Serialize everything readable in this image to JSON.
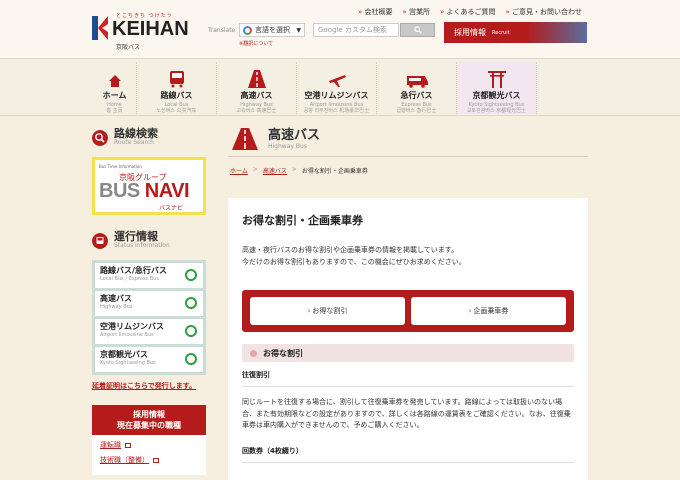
{
  "header": {
    "logo_top": "とこちきち つけたう",
    "logo_main": "KEIHAN",
    "logo_sub": "京阪バス",
    "top_links": [
      "会社概要",
      "営業所",
      "よくあるご質問",
      "ご意見・お問い合わせ"
    ],
    "translate_label": "Translate",
    "translate_select": "言語を選択",
    "translate_note": "※翻訳について",
    "search_placeholder": "Google カスタム検索",
    "recruit_label": "採用情報",
    "recruit_en": "Recruit"
  },
  "nav": {
    "items": [
      {
        "label": "ホーム",
        "sub": "Home\n홈 主页",
        "icon": "home-icon"
      },
      {
        "label": "路線バス",
        "sub": "Local Bus\n노선버스 公共汽车",
        "icon": "local-bus-icon"
      },
      {
        "label": "高速バス",
        "sub": "Highway Bus\n고속버스 高速巴士",
        "icon": "highway-icon"
      },
      {
        "label": "空港リムジンバス",
        "sub": "Airport limousine Bus\n공항 리무진버스 机场豪华巴士",
        "icon": "airplane-icon"
      },
      {
        "label": "急行バス",
        "sub": "Express Bus\n급행버스 急行巴士",
        "icon": "express-bus-icon"
      },
      {
        "label": "京都観光バス",
        "sub": "Kyoto Sightseeing Bus\n교토관광버스 京都观光巴士",
        "icon": "torii-icon"
      }
    ]
  },
  "sidebar": {
    "route_search": {
      "title": "路線検索",
      "sub": "Route Search"
    },
    "busnavi": {
      "small": "Bus Time Information",
      "group": "京阪グループ",
      "bus": "BUS",
      "navi": "NAVI",
      "kana": "バスナビ"
    },
    "status": {
      "title": "運行情報",
      "sub": "Status Information",
      "rows": [
        {
          "name": "路線バス/急行バス",
          "sub": "Local Bus / Express Bus"
        },
        {
          "name": "高速バス",
          "sub": "Highway Bus"
        },
        {
          "name": "空港リムジンバス",
          "sub": "Airport limousine Bus"
        },
        {
          "name": "京都観光バス",
          "sub": "Kyoto Sightseeing Bus"
        }
      ]
    },
    "delay_link": "延着証明はこちらで発行します。",
    "recruit": {
      "head1": "採用情報",
      "head2": "現在募集中の職種",
      "links": [
        "運転職",
        "技術職（整備）"
      ]
    }
  },
  "main": {
    "page_title": "高速バス",
    "page_sub": "Highway Bus",
    "breadcrumb": [
      "ホーム",
      "高速バス",
      "お得な割引・企画乗車券"
    ],
    "content_title": "お得な割引・企画乗車券",
    "intro": [
      "高速・夜行バスのお得な割引や企画乗車券の情報を掲載しています。",
      "今だけのお得な割引もありますので、この機会にぜひお求めください。"
    ],
    "buttons": [
      "お得な割引",
      "企画乗車券"
    ],
    "section_title": "お得な割引",
    "sub1": "往復割引",
    "body1": "同じルートを往復する場合に、割引して往復乗車券を発売しています。路線によっては取扱いのない場合、また有効期限などの設定がありますので、詳しくは各路線の運賃表をご確認ください。なお、往復乗車券は車内購入ができませんので、予めご購入ください。",
    "sub2": "回数券（4枚綴り）"
  },
  "colors": {
    "accent": "#b41c1c",
    "status_ok": "#2f9e3e",
    "page_bg": "#f6efe0"
  }
}
